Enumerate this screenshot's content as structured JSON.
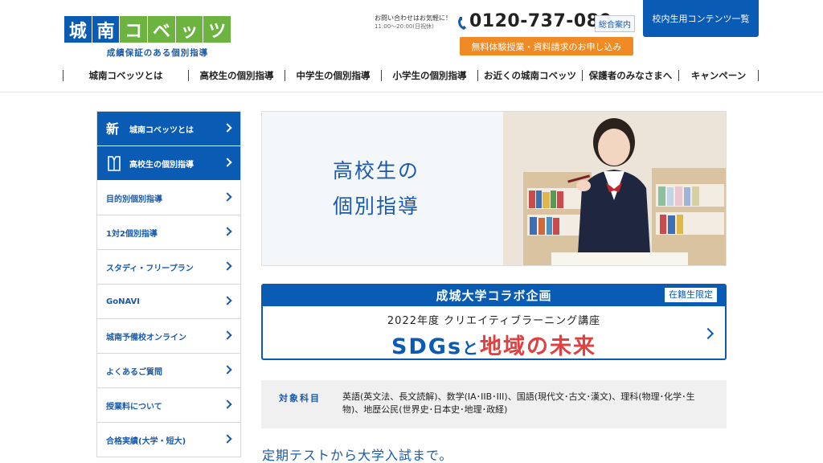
{
  "header": {
    "logo_chars": [
      "城",
      "南",
      "コ",
      "ベ",
      "ッ",
      "ツ"
    ],
    "logo_tagline": "成績保証のある個別指導",
    "contact_note": "お問い合わせはお気軽に！",
    "contact_hours": "11:00～20:00(日祝休)",
    "phone": "0120-737-080",
    "phone_badge": "総合案内",
    "cta_label": "無料体験授業・資料請求のお申し込み",
    "staff_label": "校内生用コンテンツ一覧"
  },
  "nav": {
    "items": [
      "城南コベッツとは",
      "高校生の個別指導",
      "中学生の個別指導",
      "小学生の個別指導",
      "お近くの城南コベッツ",
      "保護者のみなさまへ",
      "キャンペーン"
    ]
  },
  "sidebar": {
    "items": [
      {
        "label": "城南コベッツとは",
        "active": true,
        "icon": "new-icon"
      },
      {
        "label": "高校生の個別指導",
        "active": true,
        "icon": "uniform-icon"
      },
      {
        "label": "目的別個別指導"
      },
      {
        "label": "1対2個別指導"
      },
      {
        "label": "スタディ・フリープラン"
      },
      {
        "label": "GoNAVI"
      },
      {
        "label": "城南予備校オンライン"
      },
      {
        "label": "よくあるご質問"
      },
      {
        "label": "授業料について"
      },
      {
        "label": "合格実績(大学・短大)"
      }
    ]
  },
  "hero": {
    "line1": "高校生の",
    "line2": "個別指導"
  },
  "banner": {
    "head": "成城大学コラボ企画",
    "badge": "在籍生限定",
    "sub": "2022年度 クリエイティブラーニング講座",
    "sdgs": "SDGs",
    "to": "と",
    "region": "地域の未来"
  },
  "subjects": {
    "label": "対象科目",
    "text": "英語(英文法、長文読解)、数学(IA･IIB･III)、国語(現代文･古文･漢文)、理科(物理･化学･生物)、地歴公民(世界史･日本史･地理･政経)"
  },
  "section_heading": "定期テストから大学入試まで。",
  "colors": {
    "brand_blue": "#0a5bb4",
    "brand_green": "#6cb33f",
    "cta_orange": "#f08a24",
    "accent_red": "#e04040"
  }
}
